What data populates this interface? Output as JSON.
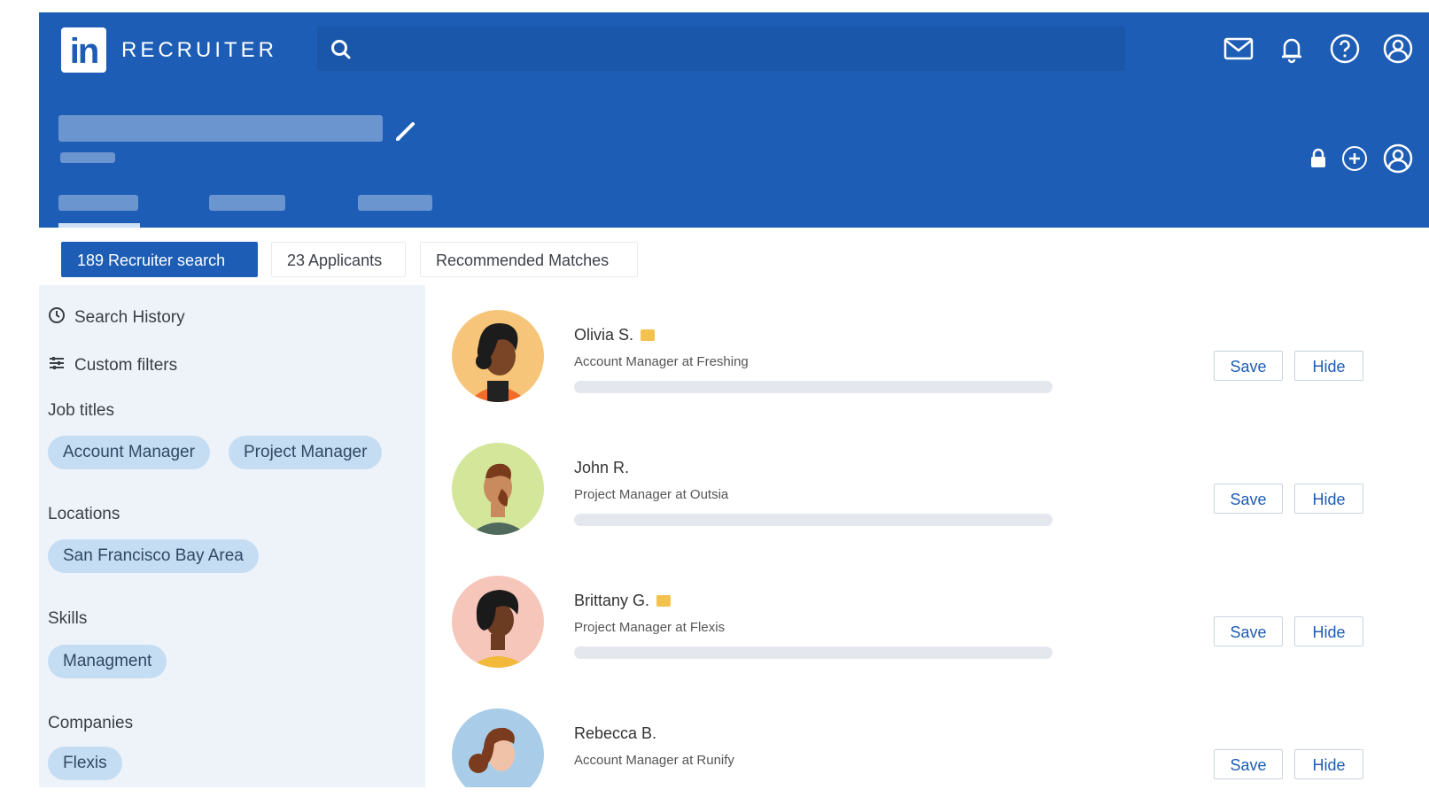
{
  "app": {
    "logo_text": "in",
    "brand": "RECRUITER"
  },
  "icons": {
    "search": "search-icon",
    "messages": "envelope-icon",
    "notifications": "bell-icon",
    "help": "question-circle-icon",
    "profile": "user-circle-icon",
    "edit": "pencil-icon",
    "lock": "lock-icon",
    "add": "plus-circle-icon",
    "history": "clock-icon",
    "filters": "sliders-icon"
  },
  "colors": {
    "brand_blue": "#1d5db5",
    "chip_bg": "#c5ddf3",
    "sidebar_bg": "#eef3fa",
    "badge": "#f2c14e"
  },
  "tabs": [
    {
      "label": "189 Recruiter search",
      "active": true
    },
    {
      "label": "23 Applicants",
      "active": false
    },
    {
      "label": "Recommended Matches",
      "active": false
    }
  ],
  "sidebar": {
    "search_history": "Search History",
    "custom_filters": "Custom filters",
    "job_titles": {
      "heading": "Job titles",
      "chips": [
        "Account Manager",
        "Project Manager"
      ]
    },
    "locations": {
      "heading": "Locations",
      "chips": [
        "San Francisco Bay Area"
      ]
    },
    "skills": {
      "heading": "Skills",
      "chips": [
        "Managment"
      ]
    },
    "companies": {
      "heading": "Companies",
      "chips": [
        "Flexis"
      ]
    }
  },
  "candidates": [
    {
      "name": "Olivia S.",
      "title": "Account Manager at Freshing",
      "badge": true,
      "save_label": "Save",
      "hide_label": "Hide"
    },
    {
      "name": "John R.",
      "title": "Project Manager at Outsia",
      "badge": false,
      "save_label": "Save",
      "hide_label": "Hide"
    },
    {
      "name": "Brittany G.",
      "title": "Project Manager at Flexis",
      "badge": true,
      "save_label": "Save",
      "hide_label": "Hide"
    },
    {
      "name": "Rebecca B.",
      "title": "Account Manager at Runify",
      "badge": false,
      "save_label": "Save",
      "hide_label": "Hide"
    }
  ]
}
